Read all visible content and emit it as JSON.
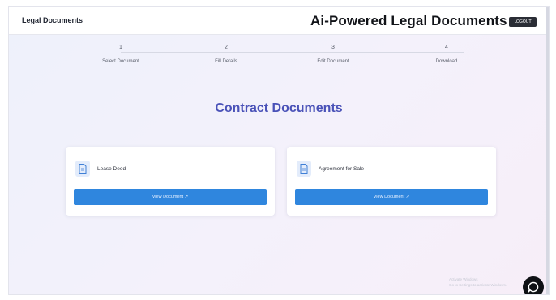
{
  "header": {
    "brand": "Legal Documents",
    "title": "Ai-Powered Legal Documents",
    "logout_label": "LOGOUT"
  },
  "stepper": {
    "steps": [
      {
        "number": "1",
        "label": "Select Document"
      },
      {
        "number": "2",
        "label": "Fill Details"
      },
      {
        "number": "3",
        "label": "Edit Document"
      },
      {
        "number": "4",
        "label": "Download"
      }
    ]
  },
  "main": {
    "section_title": "Contract Documents",
    "documents": [
      {
        "name": "Lease Deed",
        "button_label": "View Document  ↗",
        "icon": "document-icon"
      },
      {
        "name": "Agreement for Sale",
        "button_label": "View Document  ↗",
        "icon": "document-icon"
      }
    ]
  },
  "watermark": {
    "line1": "Activate Windows",
    "line2": "Go to Settings to activate Windows."
  },
  "colors": {
    "accent": "#2f86de",
    "title": "#4a52b8",
    "fab": "#0f1115"
  }
}
